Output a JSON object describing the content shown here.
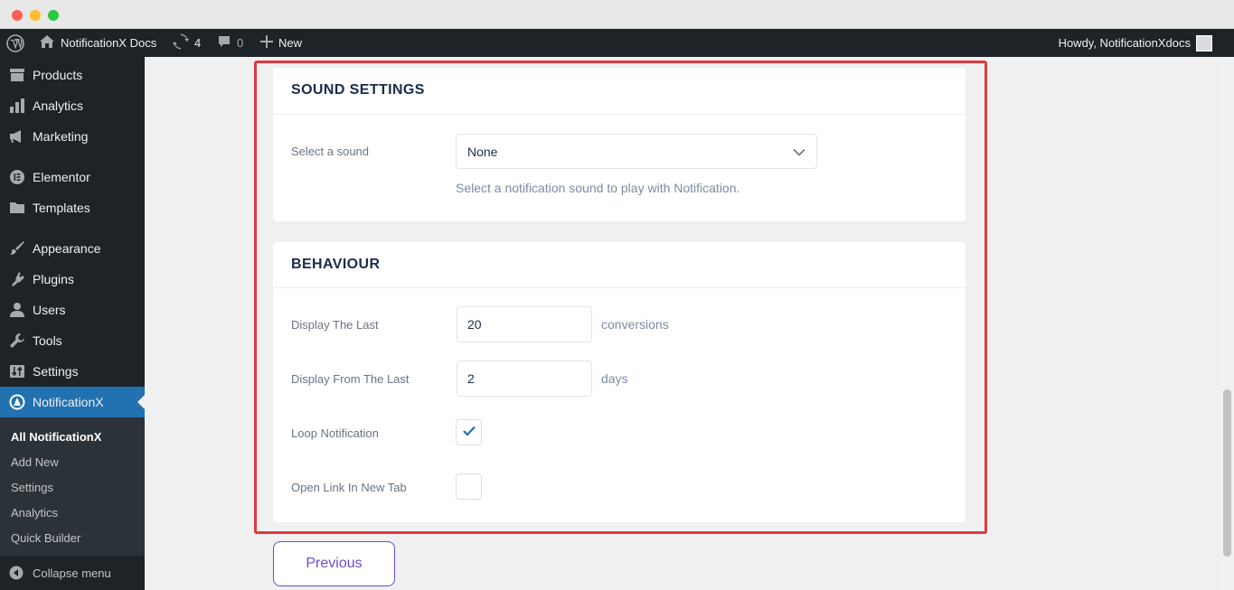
{
  "adminbar": {
    "site_name": "NotificationX Docs",
    "updates_count": "4",
    "comments_count": "0",
    "new_label": "New",
    "howdy": "Howdy, NotificationXdocs"
  },
  "sidebar": {
    "items": [
      {
        "label": "Products",
        "icon": "archive-icon"
      },
      {
        "label": "Analytics",
        "icon": "bar-chart-icon"
      },
      {
        "label": "Marketing",
        "icon": "megaphone-icon"
      },
      {
        "label": "Elementor",
        "icon": "elementor-icon"
      },
      {
        "label": "Templates",
        "icon": "folder-icon"
      },
      {
        "label": "Appearance",
        "icon": "paintbrush-icon"
      },
      {
        "label": "Plugins",
        "icon": "plug-icon"
      },
      {
        "label": "Users",
        "icon": "user-icon"
      },
      {
        "label": "Tools",
        "icon": "wrench-icon"
      },
      {
        "label": "Settings",
        "icon": "sliders-icon"
      },
      {
        "label": "NotificationX",
        "icon": "notificationx-icon"
      }
    ],
    "submenu": [
      "All NotificationX",
      "Add New",
      "Settings",
      "Analytics",
      "Quick Builder"
    ],
    "collapse_label": "Collapse menu"
  },
  "sound": {
    "title": "SOUND SETTINGS",
    "select_label": "Select a sound",
    "select_value": "None",
    "help": "Select a notification sound to play with Notification."
  },
  "behaviour": {
    "title": "BEHAVIOUR",
    "display_last_label": "Display The Last",
    "display_last_value": "20",
    "display_last_suffix": "conversions",
    "display_from_label": "Display From The Last",
    "display_from_value": "2",
    "display_from_suffix": "days",
    "loop_label": "Loop Notification",
    "loop_checked": true,
    "new_tab_label": "Open Link In New Tab",
    "new_tab_checked": false
  },
  "footer": {
    "previous_label": "Previous"
  },
  "colors": {
    "accent": "#6a4bd1",
    "admin_active": "#2271b1",
    "highlight": "#e0393e"
  }
}
